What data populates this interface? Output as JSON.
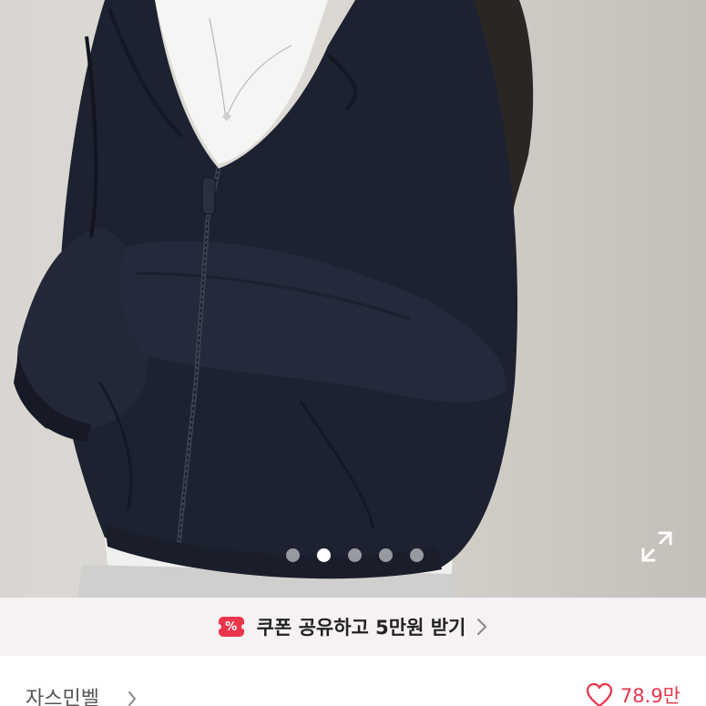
{
  "gallery": {
    "image_alt": "navy zip-up hoodie",
    "pager_total": 5,
    "pager_active": 2,
    "expand_icon": "expand-icon"
  },
  "coupon": {
    "icon_glyph": "%",
    "text": "쿠폰 공유하고 5만원 받기",
    "chevron_icon": "chevron-right-icon",
    "icon_color": "#e8354c",
    "background": "#f6f1f2"
  },
  "shop": {
    "name": "자스민벨",
    "chevron_icon": "chevron-right-icon",
    "like_count": "78.9만",
    "like_icon": "heart-outline-icon",
    "accent": "#e8354c"
  }
}
